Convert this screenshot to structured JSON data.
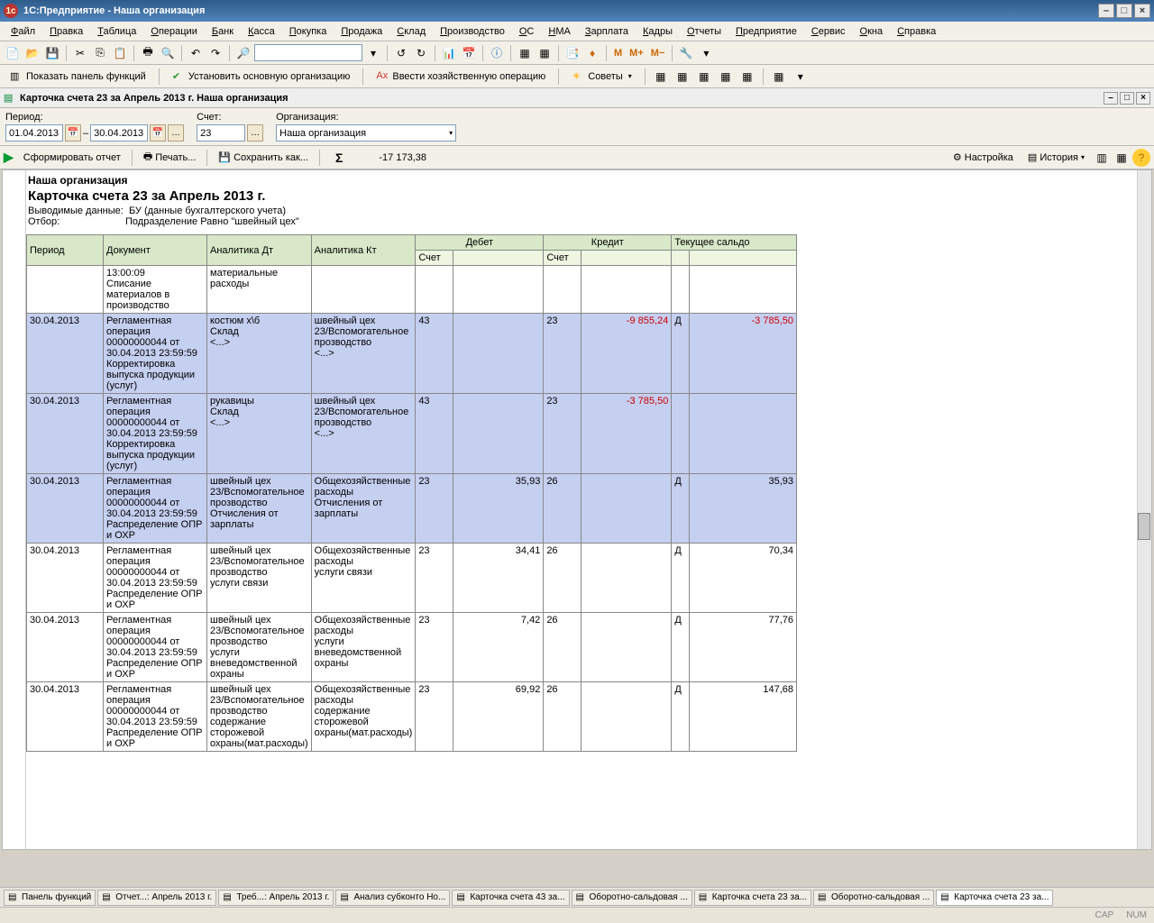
{
  "window": {
    "title": "1С:Предприятие - Наша организация"
  },
  "menu": [
    "Файл",
    "Правка",
    "Таблица",
    "Операции",
    "Банк",
    "Касса",
    "Покупка",
    "Продажа",
    "Склад",
    "Производство",
    "ОС",
    "НМА",
    "Зарплата",
    "Кадры",
    "Отчеты",
    "Предприятие",
    "Сервис",
    "Окна",
    "Справка"
  ],
  "actions": {
    "a1": "Показать панель функций",
    "a2": "Установить основную организацию",
    "a3": "Ввести хозяйственную операцию",
    "a4": "Советы"
  },
  "doctab": {
    "title": "Карточка счета 23 за Апрель 2013 г. Наша организация"
  },
  "filter": {
    "period_lbl": "Период:",
    "d1": "01.04.2013",
    "d2": "30.04.2013",
    "acct_lbl": "Счет:",
    "acct": "23",
    "org_lbl": "Организация:",
    "org": "Наша организация"
  },
  "repbar": {
    "form": "Сформировать отчет",
    "print": "Печать...",
    "save": "Сохранить как...",
    "sum": "-17 173,38",
    "settings": "Настройка",
    "history": "История"
  },
  "report": {
    "org": "Наша организация",
    "title": "Карточка счета 23 за Апрель 2013 г.",
    "sub_lbl": "Выводимые данные:",
    "sub_val": "БУ (данные бухгалтерского учета)",
    "filt_lbl": "Отбор:",
    "filt_val": "Подразделение Равно \"швейный цех\"",
    "headers": {
      "period": "Период",
      "doc": "Документ",
      "adt": "Аналитика Дт",
      "akt": "Аналитика Кт",
      "debit": "Дебет",
      "credit": "Кредит",
      "bal": "Текущее сальдо",
      "acct": "Счет"
    },
    "rows": [
      {
        "sel": false,
        "period": "",
        "doc": "13:00:09\nСписание материалов в производство",
        "adt": "материальные расходы",
        "akt": "",
        "dacc": "",
        "dval": "",
        "cacc": "",
        "cval": "",
        "btype": "",
        "bval": ""
      },
      {
        "sel": true,
        "period": "30.04.2013",
        "doc": "Регламентная операция 00000000044 от 30.04.2013 23:59:59\nКорректировка выпуска продукции (услуг)",
        "adt": "костюм х\\б\nСклад\n<...>",
        "akt": "швейный цех\n23/Вспомогательное прозводство\n<...>",
        "dacc": "43",
        "dval": "",
        "cacc": "23",
        "cval": "-9 855,24",
        "btype": "Д",
        "bval": "-3 785,50"
      },
      {
        "sel": true,
        "period": "30.04.2013",
        "doc": "Регламентная операция 00000000044 от 30.04.2013 23:59:59\nКорректировка выпуска продукции (услуг)",
        "adt": "рукавицы\nСклад\n<...>",
        "akt": "швейный цех\n23/Вспомогательное прозводство\n<...>",
        "dacc": "43",
        "dval": "",
        "cacc": "23",
        "cval": "-3 785,50",
        "btype": "",
        "bval": ""
      },
      {
        "sel": true,
        "period": "30.04.2013",
        "doc": "Регламентная операция 00000000044 от 30.04.2013 23:59:59\nРаспределение ОПР и ОХР",
        "adt": "швейный цех\n23/Вспомогательное прозводство\nОтчисления от зарплаты",
        "akt": "Общехозяйственные расходы\nОтчисления от зарплаты",
        "dacc": "23",
        "dval": "35,93",
        "cacc": "26",
        "cval": "",
        "btype": "Д",
        "bval": "35,93"
      },
      {
        "sel": false,
        "period": "30.04.2013",
        "doc": "Регламентная операция 00000000044 от 30.04.2013 23:59:59\nРаспределение ОПР и ОХР",
        "adt": "швейный цех\n23/Вспомогательное прозводство\nуслуги связи",
        "akt": "Общехозяйственные расходы\nуслуги связи",
        "dacc": "23",
        "dval": "34,41",
        "cacc": "26",
        "cval": "",
        "btype": "Д",
        "bval": "70,34"
      },
      {
        "sel": false,
        "period": "30.04.2013",
        "doc": "Регламентная операция 00000000044 от 30.04.2013 23:59:59\nРаспределение ОПР и ОХР",
        "adt": "швейный цех\n23/Вспомогательное прозводство\nуслуги вневедомственной охраны",
        "akt": "Общехозяйственные расходы\nуслуги вневедомственной охраны",
        "dacc": "23",
        "dval": "7,42",
        "cacc": "26",
        "cval": "",
        "btype": "Д",
        "bval": "77,76"
      },
      {
        "sel": false,
        "period": "30.04.2013",
        "doc": "Регламентная операция 00000000044 от 30.04.2013 23:59:59\nРаспределение ОПР и ОХР",
        "adt": "швейный цех\n23/Вспомогательное прозводство\nсодержание сторожевой охраны(мат.расходы)",
        "akt": "Общехозяйственные расходы\nсодержание сторожевой охраны(мат.расходы)",
        "dacc": "23",
        "dval": "69,92",
        "cacc": "26",
        "cval": "",
        "btype": "Д",
        "bval": "147,68"
      }
    ]
  },
  "wintabs": [
    "Панель функций",
    "Отчет...: Апрель 2013 г.",
    "Треб...: Апрель 2013 г.",
    "Анализ субконто Но...",
    "Карточка счета 43 за...",
    "Оборотно-сальдовая ...",
    "Карточка счета 23 за...",
    "Оборотно-сальдовая ...",
    "Карточка счета 23 за..."
  ],
  "status": {
    "cap": "CAP",
    "num": "NUM"
  }
}
